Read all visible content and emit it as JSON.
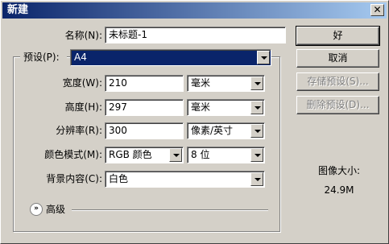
{
  "window": {
    "title": "新建",
    "close_glyph": "✕"
  },
  "name": {
    "label": "名称(N):",
    "value": "未标题-1"
  },
  "preset": {
    "label": "预设(P):",
    "value": "A4"
  },
  "width": {
    "label": "宽度(W):",
    "value": "210",
    "unit": "毫米"
  },
  "height": {
    "label": "高度(H):",
    "value": "297",
    "unit": "毫米"
  },
  "resolution": {
    "label": "分辨率(R):",
    "value": "300",
    "unit": "像素/英寸"
  },
  "color_mode": {
    "label": "颜色模式(M):",
    "value": "RGB 颜色",
    "depth": "8 位"
  },
  "background": {
    "label": "背景内容(C):",
    "value": "白色"
  },
  "advanced": {
    "label": "高级",
    "icon": "double-chevron-down-icon"
  },
  "buttons": {
    "ok": "好",
    "cancel": "取消",
    "save_preset": "存储预设(S)...",
    "delete_preset": "删除预设(D)..."
  },
  "image_size": {
    "label": "图像大小:",
    "value": "24.9M"
  },
  "colors": {
    "titlebar_start": "#0a246a",
    "titlebar_end": "#a6caf0",
    "selection": "#0a246a",
    "face": "#d4d0c8"
  }
}
